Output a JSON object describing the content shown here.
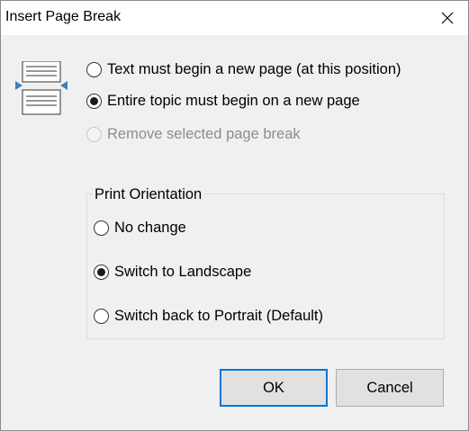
{
  "window": {
    "title": "Insert Page Break"
  },
  "options": [
    {
      "label": "Text must begin a new page (at this position)",
      "selected": false,
      "disabled": false
    },
    {
      "label": "Entire topic must begin on a new page",
      "selected": true,
      "disabled": false
    },
    {
      "label": "Remove selected page break",
      "selected": false,
      "disabled": true
    }
  ],
  "orientation": {
    "title": "Print Orientation",
    "options": [
      {
        "label": "No change",
        "selected": false
      },
      {
        "label": "Switch to Landscape",
        "selected": true
      },
      {
        "label": "Switch back to Portrait (Default)",
        "selected": false
      }
    ]
  },
  "buttons": {
    "ok": "OK",
    "cancel": "Cancel"
  },
  "colors": {
    "accent": "#0078d7",
    "icon_blue": "#3c7fc2",
    "dialog_bg": "#f0f0f0"
  }
}
